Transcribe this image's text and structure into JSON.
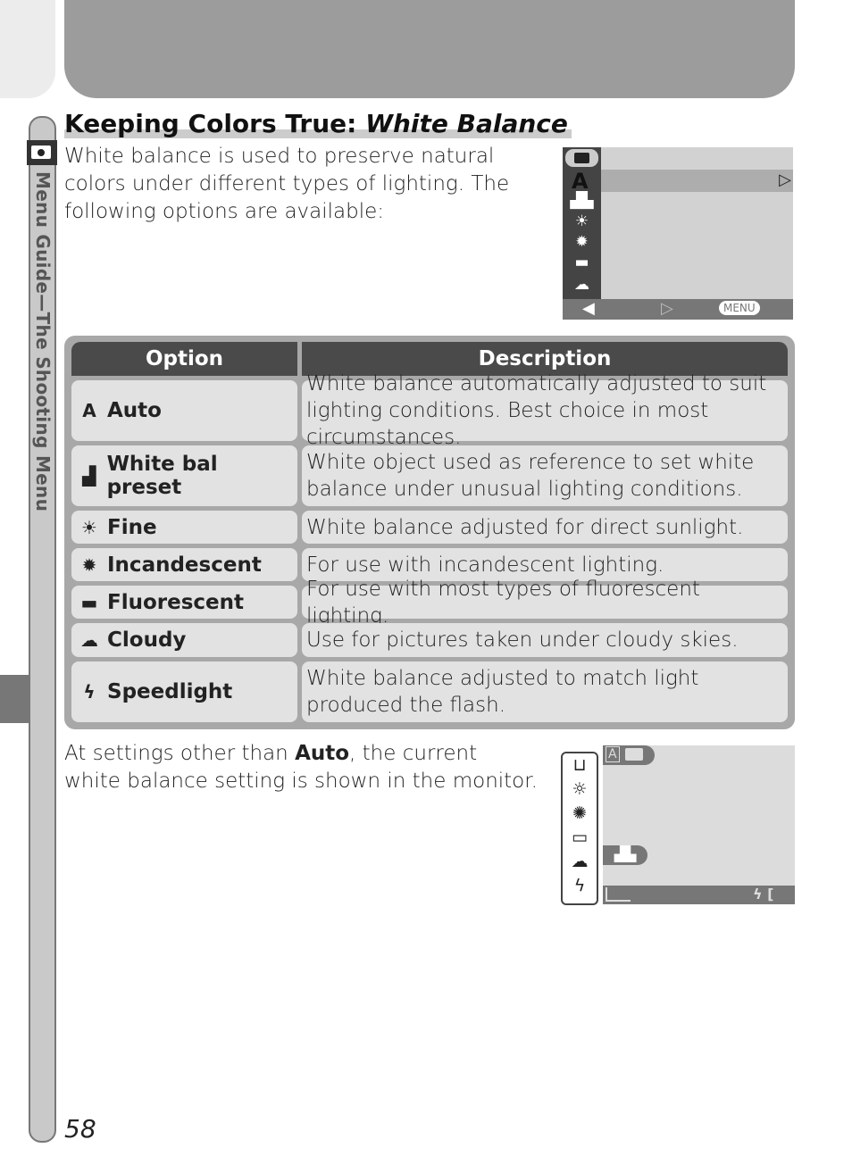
{
  "side_tab": {
    "label": "Menu Guide—The Shooting Menu",
    "icon": "camera-icon"
  },
  "title": {
    "main": "Keeping Colors True: ",
    "italic": "White Balance"
  },
  "intro": "White balance is used to preserve natural colors under different types of lighting.  The following options are available:",
  "screen1": {
    "selected": "A",
    "items": [
      "white-bal-preset-icon",
      "fine-icon",
      "incandescent-icon",
      "fluorescent-icon",
      "cloudy-icon"
    ],
    "menu_label": "MENU"
  },
  "table": {
    "headers": {
      "option": "Option",
      "description": "Description"
    },
    "rows": [
      {
        "icon": "auto-icon",
        "glyph": "A",
        "option": "Auto",
        "description": "White balance automatically adjusted to suit lighting conditions.  Best choice in most circumstances."
      },
      {
        "icon": "white-bal-preset-icon",
        "glyph": "▟",
        "option": "White bal preset",
        "description": "White object used as reference to set white balance under unusual lighting conditions."
      },
      {
        "icon": "fine-icon",
        "glyph": "☀",
        "option": "Fine",
        "description": "White balance adjusted for direct sunlight."
      },
      {
        "icon": "incandescent-icon",
        "glyph": "✹",
        "option": "Incandescent",
        "description": "For use with incandescent lighting."
      },
      {
        "icon": "fluorescent-icon",
        "glyph": "▬",
        "option": "Fluorescent",
        "description": "For use with most types of fluorescent lighting."
      },
      {
        "icon": "cloudy-icon",
        "glyph": "☁",
        "option": "Cloudy",
        "description": "Use for pictures taken under cloudy skies."
      },
      {
        "icon": "speedlight-icon",
        "glyph": "ϟ",
        "option": "Speedlight",
        "description": "White balance adjusted to match light produced the flash."
      }
    ]
  },
  "after": {
    "pre": "At settings other than ",
    "bold": "Auto",
    "post": ", the current white balance setting is shown in the monitor."
  },
  "monitor": {
    "mode": "A"
  },
  "page_number": "58"
}
